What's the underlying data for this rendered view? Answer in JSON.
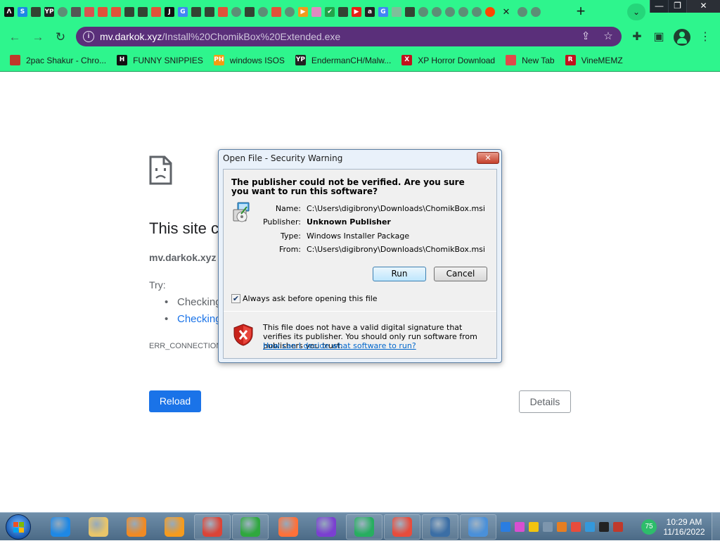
{
  "browser": {
    "tabs": [
      {
        "icon": "letter-a-icon",
        "glyph": "Λ",
        "color": "#111111"
      },
      {
        "icon": "blue-s-icon",
        "glyph": "S",
        "color": "#1e88e5"
      },
      {
        "icon": "bookmark-shield-icon",
        "glyph": "",
        "color": "#334433"
      },
      {
        "icon": "yp-icon",
        "glyph": "YP",
        "color": "#222222"
      },
      {
        "icon": "globe-icon",
        "glyph": "",
        "color": "#5c8f76"
      },
      {
        "icon": "windows-app-icon",
        "glyph": "",
        "color": "#555555"
      },
      {
        "icon": "red-app-icon",
        "glyph": "",
        "color": "#d9534f"
      },
      {
        "icon": "brave-icon",
        "glyph": "",
        "color": "#e0533a"
      },
      {
        "icon": "brave-icon",
        "glyph": "",
        "color": "#e0533a"
      },
      {
        "icon": "bookmark-shield-icon",
        "glyph": "",
        "color": "#334433"
      },
      {
        "icon": "bookmark-shield-icon",
        "glyph": "",
        "color": "#334433"
      },
      {
        "icon": "brave-icon",
        "glyph": "",
        "color": "#e0533a"
      },
      {
        "icon": "letter-j-icon",
        "glyph": "J",
        "color": "#111111"
      },
      {
        "icon": "google-icon",
        "glyph": "G",
        "color": "#4285f4"
      },
      {
        "icon": "bookmark-shield-icon",
        "glyph": "",
        "color": "#334433"
      },
      {
        "icon": "bookmark-shield-icon",
        "glyph": "",
        "color": "#334433"
      },
      {
        "icon": "brave-icon",
        "glyph": "",
        "color": "#e0533a"
      },
      {
        "icon": "globe-icon",
        "glyph": "",
        "color": "#5c8f76"
      },
      {
        "icon": "bookmark-shield-icon",
        "glyph": "",
        "color": "#334433"
      },
      {
        "icon": "globe-icon",
        "glyph": "",
        "color": "#5c8f76"
      },
      {
        "icon": "brave-icon",
        "glyph": "",
        "color": "#e0533a"
      },
      {
        "icon": "globe-icon",
        "glyph": "",
        "color": "#5c8f76"
      },
      {
        "icon": "play-icon",
        "glyph": "▶",
        "color": "#f29b1d"
      },
      {
        "icon": "puzzle-icon",
        "glyph": "",
        "color": "#e08ac0"
      },
      {
        "icon": "check-icon",
        "glyph": "✔",
        "color": "#22a34a"
      },
      {
        "icon": "bookmark-shield-icon",
        "glyph": "",
        "color": "#334433"
      },
      {
        "icon": "youtube-icon",
        "glyph": "▶",
        "color": "#e62117"
      },
      {
        "icon": "amazon-icon",
        "glyph": "a",
        "color": "#222222"
      },
      {
        "icon": "google-icon",
        "glyph": "G",
        "color": "#4285f4"
      },
      {
        "icon": "page-icon",
        "glyph": "",
        "color": "#7fbf9a"
      },
      {
        "icon": "bookmark-shield-icon",
        "glyph": "",
        "color": "#334433"
      },
      {
        "icon": "globe-icon",
        "glyph": "",
        "color": "#5c8f76"
      },
      {
        "icon": "globe-icon",
        "glyph": "",
        "color": "#5c8f76"
      },
      {
        "icon": "globe-icon",
        "glyph": "",
        "color": "#5c8f76"
      },
      {
        "icon": "globe-icon",
        "glyph": "",
        "color": "#5c8f76"
      },
      {
        "icon": "globe-icon",
        "glyph": "",
        "color": "#5c8f76"
      },
      {
        "icon": "reddit-icon",
        "glyph": "",
        "color": "#ff4500"
      },
      {
        "icon": "close-tab-icon",
        "glyph": "✕",
        "color": "",
        "active": true
      },
      {
        "icon": "globe-icon",
        "glyph": "",
        "color": "#5c8f76"
      },
      {
        "icon": "globe-icon",
        "glyph": "",
        "color": "#5c8f76"
      }
    ],
    "new_tab_glyph": "+",
    "tab_search_glyph": "⌄",
    "window_controls": {
      "minimize": "—",
      "restore": "❐",
      "close": "✕"
    },
    "back_glyph": "←",
    "forward_glyph": "→",
    "reload_glyph": "↻",
    "info_glyph": "i",
    "url_host": "mv.darkok.xyz",
    "url_path": "/Install%20ChomikBox%20Extended.exe",
    "share_glyph": "⇪",
    "star_glyph": "☆",
    "extensions_glyph": "✚",
    "sidepanel_glyph": "▣",
    "menu_glyph": "⋮",
    "theme_color": "#2ef58d",
    "omnibox_color": "#5a2f7a"
  },
  "bookmarks": [
    {
      "label": "2pac Shakur - Chro...",
      "icon": "bookmark-favicon-icon",
      "glyph": "",
      "color": "#c0392b"
    },
    {
      "label": "FUNNY SNIPPIES",
      "icon": "h-icon",
      "glyph": "H",
      "color": "#111111"
    },
    {
      "label": "windows ISOS",
      "icon": "ph-icon",
      "glyph": "PH",
      "color": "#f39c12"
    },
    {
      "label": "EndermanCH/Malw...",
      "icon": "yp-icon",
      "glyph": "YP",
      "color": "#222222"
    },
    {
      "label": "XP Horror Download",
      "icon": "x-icon",
      "glyph": "X",
      "color": "#c0121c"
    },
    {
      "label": "New Tab",
      "icon": "new-tab-icon",
      "glyph": "",
      "color": "#e04a4a"
    },
    {
      "label": "VineMEMZ",
      "icon": "r-icon",
      "glyph": "R",
      "color": "#c0121c"
    }
  ],
  "error_page": {
    "title": "This site c",
    "host": "mv.darkok.xyz",
    "try_label": "Try:",
    "suggestions": [
      "Checking",
      "Checking"
    ],
    "error_code": "ERR_CONNECTION",
    "reload_label": "Reload",
    "details_label": "Details"
  },
  "dialog": {
    "title": "Open File - Security Warning",
    "close_glyph": "✕",
    "headline": "The publisher could not be verified.  Are you sure you want to run this software?",
    "fields": [
      {
        "label": "Name:",
        "value": "C:\\Users\\digibrony\\Downloads\\ChomikBox.msi",
        "bold": false
      },
      {
        "label": "Publisher:",
        "value": "Unknown Publisher",
        "bold": true
      },
      {
        "label": "Type:",
        "value": "Windows Installer Package",
        "bold": false
      },
      {
        "label": "From:",
        "value": "C:\\Users\\digibrony\\Downloads\\ChomikBox.msi",
        "bold": false
      }
    ],
    "run_label": "Run",
    "cancel_label": "Cancel",
    "always_ask_checked": true,
    "always_ask_label": "Always ask before opening this file",
    "warning_text": "This file does not have a valid digital signature that verifies its publisher.  You should only run software from publishers you trust.",
    "warning_link": "How can I decide what software to run?"
  },
  "taskbar": {
    "apps": [
      {
        "name": "internet-explorer-icon",
        "color": "#1e88e5",
        "pinned": false
      },
      {
        "name": "file-explorer-icon",
        "color": "#e8c56a",
        "pinned": false
      },
      {
        "name": "media-player-icon",
        "color": "#f08a24",
        "pinned": false
      },
      {
        "name": "uc-browser-icon",
        "color": "#f59b1e",
        "pinned": false
      },
      {
        "name": "chrome-icon",
        "color": "#db4437",
        "pinned": true
      },
      {
        "name": "green-plus-app-icon",
        "color": "#2fa83e",
        "pinned": true
      },
      {
        "name": "firefox-icon",
        "color": "#ff7139",
        "pinned": false
      },
      {
        "name": "purple-mask-app-icon",
        "color": "#7b3fd1",
        "pinned": false
      },
      {
        "name": "green-umbrella-app-icon",
        "color": "#27ae60",
        "pinned": true
      },
      {
        "name": "colorful-tiles-app-icon",
        "color": "#e74c3c",
        "pinned": true
      },
      {
        "name": "window-app-icon",
        "color": "#3b6ea5",
        "pinned": true
      },
      {
        "name": "blue-app-icon",
        "color": "#4a90d9",
        "pinned": true
      }
    ],
    "tray_icons": [
      {
        "name": "tray-blue-icon",
        "color": "#2a7de1"
      },
      {
        "name": "tray-colorful-icon",
        "color": "#d94fd1"
      },
      {
        "name": "tray-plus-icon",
        "color": "#f1c40f"
      },
      {
        "name": "tray-separator-icon",
        "color": "#7d96ad"
      },
      {
        "name": "tray-search-icon",
        "color": "#e67e22"
      },
      {
        "name": "tray-flag-icon",
        "color": "#e74c3c"
      },
      {
        "name": "tray-monitor-icon",
        "color": "#3498db"
      },
      {
        "name": "tray-record-icon",
        "color": "#222222"
      },
      {
        "name": "tray-network-icon",
        "color": "#c0392b"
      }
    ],
    "badge": "75",
    "time": "10:29 AM",
    "date": "11/16/2022"
  }
}
